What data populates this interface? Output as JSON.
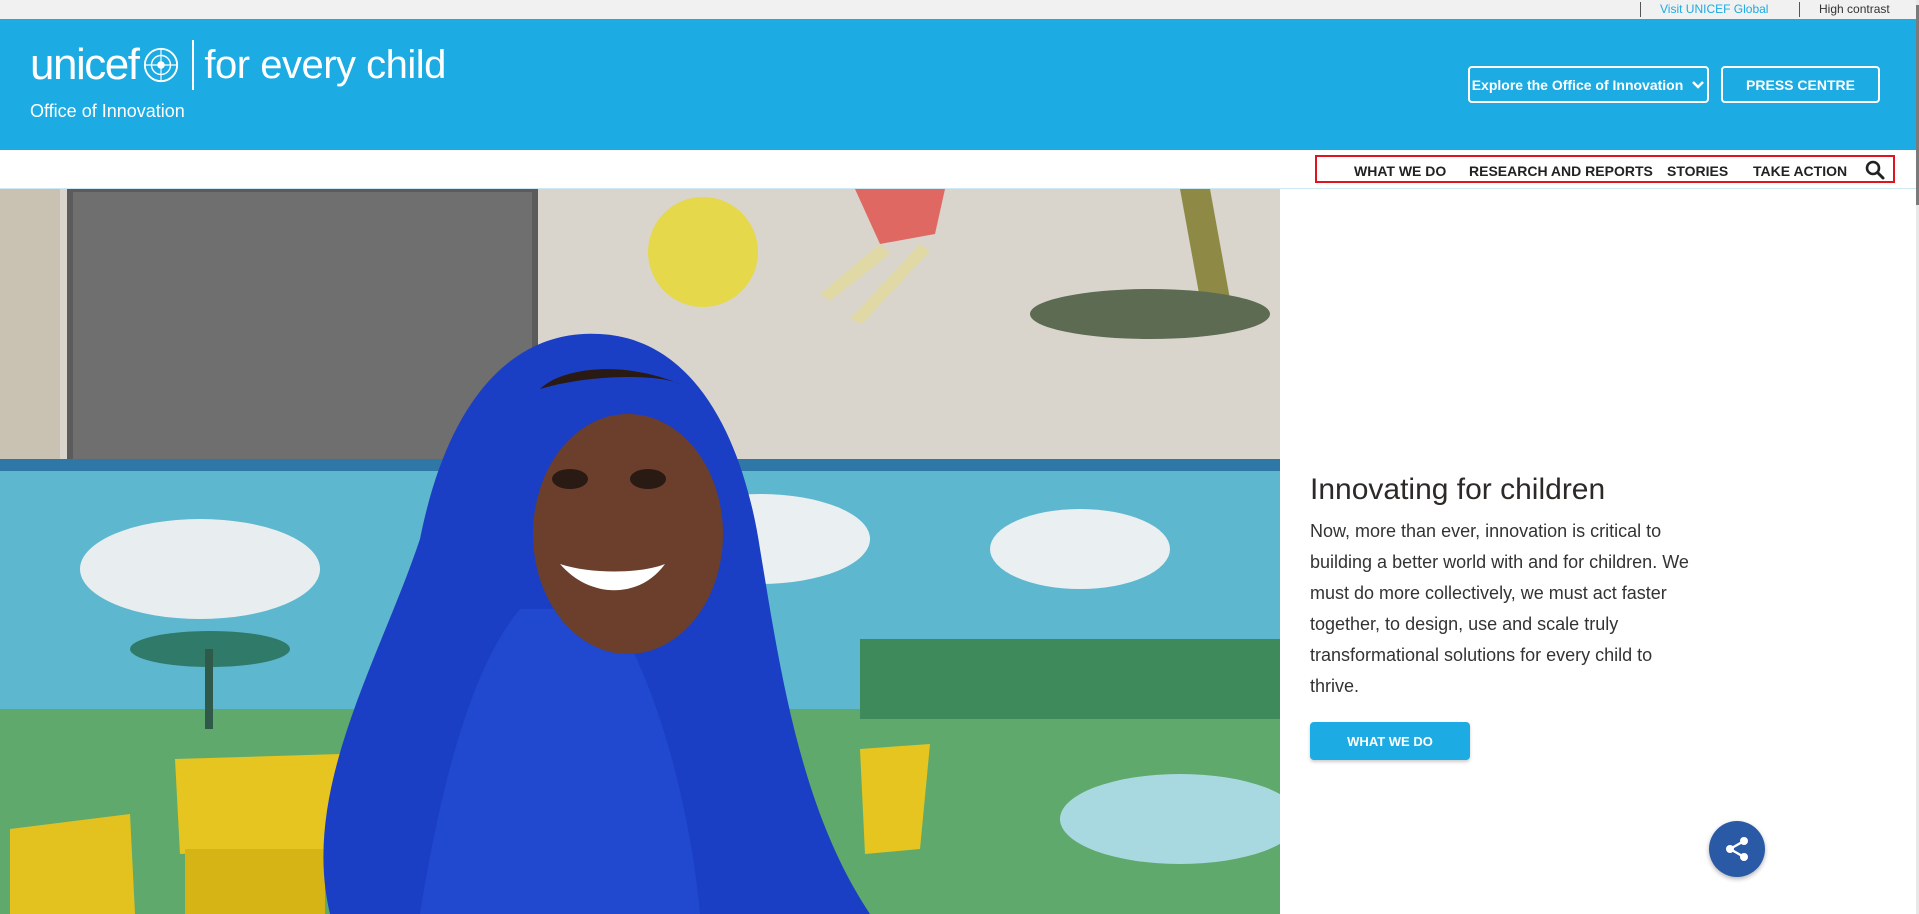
{
  "utility": {
    "visit_label": "Visit UNICEF Global",
    "contrast_label": "High contrast"
  },
  "header": {
    "logo_word": "unicef",
    "logo_tagline": "for every child",
    "office_label": "Office of Innovation",
    "explore_label": "Explore the Office of Innovation",
    "press_label": "PRESS CENTRE",
    "brand_color": "#1cabe2"
  },
  "nav": {
    "items": [
      {
        "label": "WHAT WE DO"
      },
      {
        "label": "RESEARCH AND REPORTS"
      },
      {
        "label": "STORIES"
      },
      {
        "label": "TAKE ACTION"
      }
    ],
    "highlight_color": "#e0141e"
  },
  "hero": {
    "title": "Innovating for children",
    "body": "Now, more than ever, innovation is critical to building a better world with and for children. We must do more collectively, we must act faster together, to design, use and scale truly transformational solutions for every child to thrive.",
    "cta_label": "WHAT WE DO"
  },
  "share": {
    "icon": "share-icon",
    "color": "#2a5aa6"
  }
}
